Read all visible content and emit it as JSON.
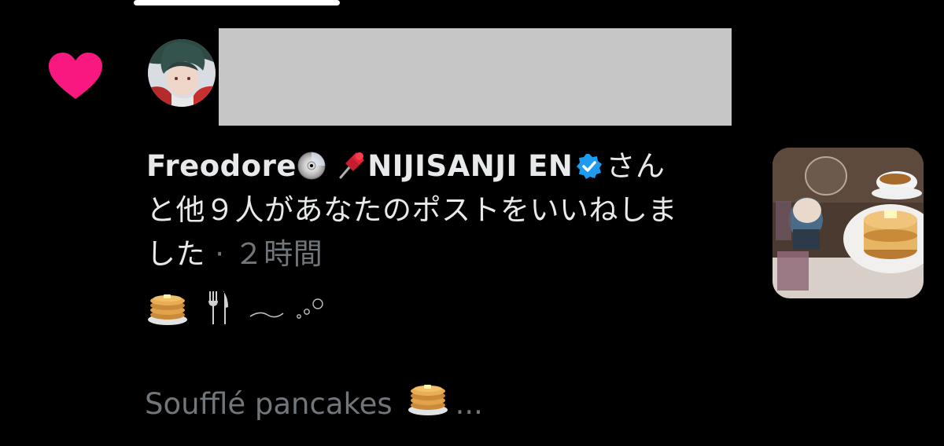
{
  "notification": {
    "actor": "Freodore",
    "other_actor": "NIJISANJI EN",
    "text_line1_suffix": "さん",
    "text_line2": "と他９人があなたのポストをいいねしま",
    "text_line3": "した",
    "separator": " · ",
    "timestamp": "２時間"
  },
  "post": {
    "preview_text": "Soufflé pancakes",
    "ellipsis": "..."
  },
  "icons": {
    "like": "heart-icon",
    "verified": "verified-badge-icon",
    "cd": "cd-icon",
    "pin": "pushpin-icon",
    "pancakes": "pancakes-icon",
    "cutlery": "fork-knife-icon"
  },
  "colors": {
    "background": "#000000",
    "heart": "#f91880",
    "verified": "#1d9bf0",
    "text_primary": "#e7e9ea",
    "text_secondary": "#71767b",
    "redaction": "#c6c6c6"
  }
}
